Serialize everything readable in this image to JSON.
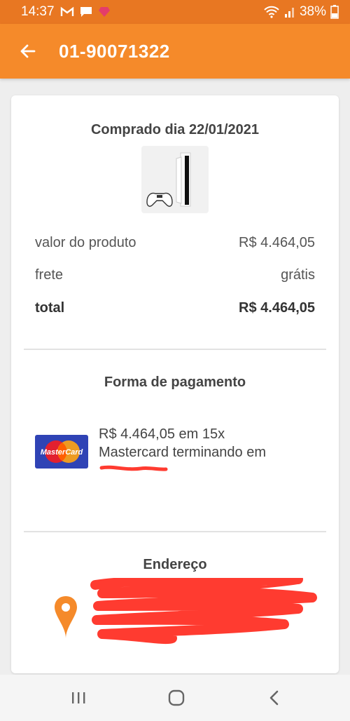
{
  "status_bar": {
    "time": "14:37",
    "battery": "38%",
    "icons": [
      "gmail-icon",
      "chat-icon",
      "heart-app-icon",
      "wifi-icon",
      "signal-icon",
      "battery-icon"
    ]
  },
  "app_bar": {
    "title": "01-90071322",
    "back_icon": "arrow-left-icon"
  },
  "purchase": {
    "title": "Comprado dia 22/01/2021",
    "rows": [
      {
        "label": "valor do produto",
        "value": "R$ 4.464,05"
      },
      {
        "label": "frete",
        "value": "grátis"
      },
      {
        "label": "total",
        "value": "R$ 4.464,05"
      }
    ]
  },
  "payment": {
    "title": "Forma de pagamento",
    "brand": "MasterCard",
    "line1": "R$ 4.464,05 em 15x",
    "line2": "Mastercard terminando em"
  },
  "address": {
    "title": "Endereço",
    "icon": "location-pin-icon"
  },
  "colors": {
    "status_bar": "#e87722",
    "app_bar": "#f58a2a",
    "accent_orange": "#f58a2a",
    "redaction": "#ff3b30"
  }
}
